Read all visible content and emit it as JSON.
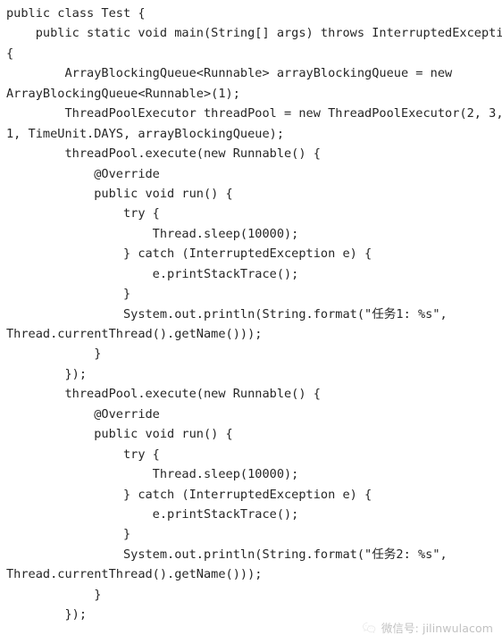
{
  "document": {
    "kind": "code-screenshot",
    "language": "Java",
    "background_color": "#ffffff",
    "text_color": "#262626"
  },
  "code": {
    "lines": [
      "public class Test {",
      "    public static void main(String[] args) throws InterruptedException",
      "{",
      "        ArrayBlockingQueue<Runnable> arrayBlockingQueue = new",
      "ArrayBlockingQueue<Runnable>(1);",
      "        ThreadPoolExecutor threadPool = new ThreadPoolExecutor(2, 3,",
      "1, TimeUnit.DAYS, arrayBlockingQueue);",
      "        threadPool.execute(new Runnable() {",
      "            @Override",
      "            public void run() {",
      "                try {",
      "                    Thread.sleep(10000);",
      "                } catch (InterruptedException e) {",
      "                    e.printStackTrace();",
      "                }",
      "                System.out.println(String.format(\"任务1: %s\",",
      "Thread.currentThread().getName()));",
      "            }",
      "        });",
      "        threadPool.execute(new Runnable() {",
      "            @Override",
      "            public void run() {",
      "                try {",
      "                    Thread.sleep(10000);",
      "                } catch (InterruptedException e) {",
      "                    e.printStackTrace();",
      "                }",
      "                System.out.println(String.format(\"任务2: %s\",",
      "Thread.currentThread().getName()));",
      "            }",
      "        });"
    ]
  },
  "watermark": {
    "icon": "wechat-icon",
    "text": "微信号: jilinwulacom",
    "color": "#8f8f8f"
  }
}
